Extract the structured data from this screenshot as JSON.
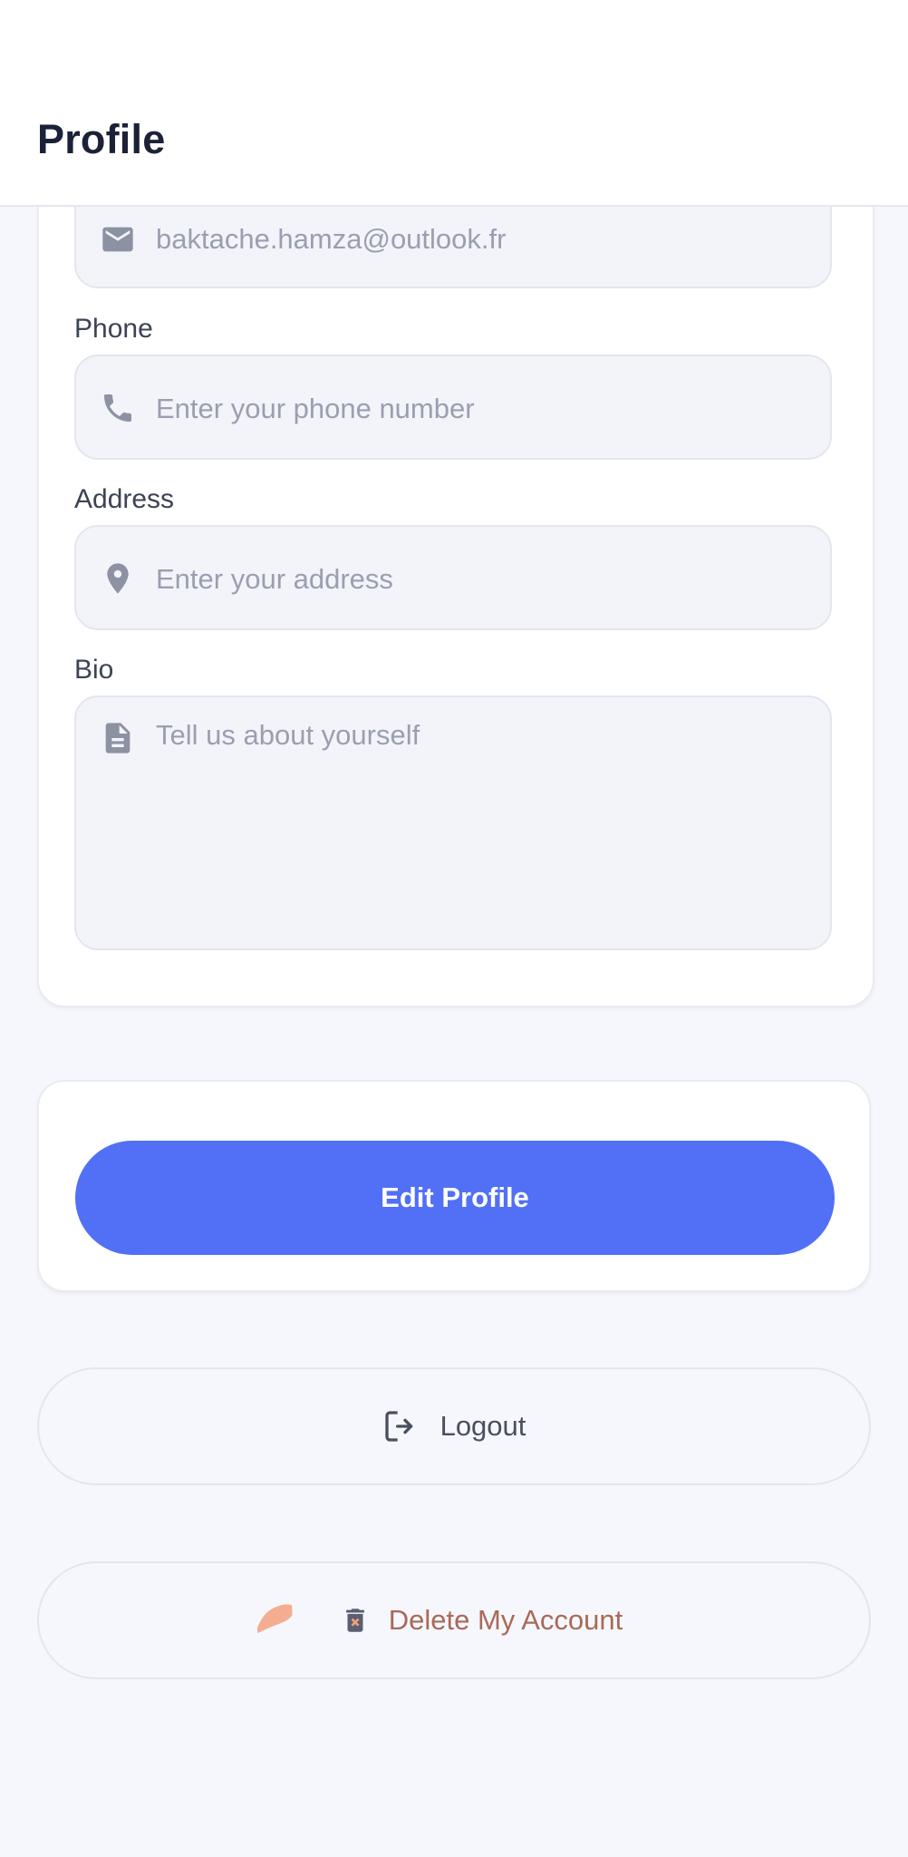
{
  "header": {
    "title": "Profile"
  },
  "form": {
    "email": {
      "value": "baktache.hamza@outlook.fr",
      "icon": "email-icon"
    },
    "phone": {
      "label": "Phone",
      "placeholder": "Enter your phone number",
      "icon": "phone-icon"
    },
    "address": {
      "label": "Address",
      "placeholder": "Enter your address",
      "icon": "location-pin-icon"
    },
    "bio": {
      "label": "Bio",
      "placeholder": "Tell us about yourself",
      "icon": "document-icon"
    }
  },
  "actions": {
    "edit_profile": "Edit Profile",
    "logout": "Logout",
    "delete_account": "Delete My Account"
  },
  "colors": {
    "accent": "#5170f6",
    "highlight": "#f4a07f",
    "background": "#f6f7fc"
  }
}
